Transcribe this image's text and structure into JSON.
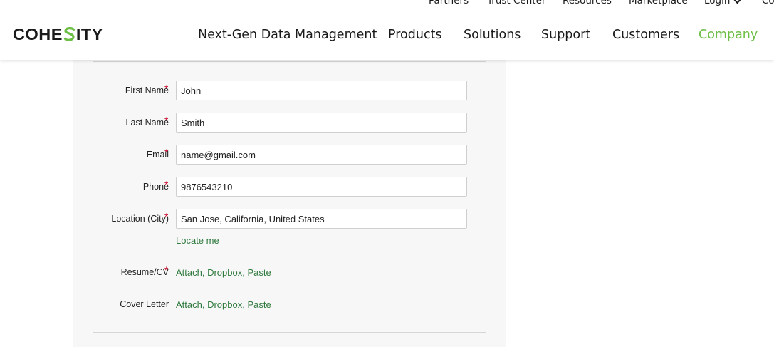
{
  "header": {
    "logo_text_left": "COHE",
    "logo_text_right": "ITY",
    "utility_links": {
      "partners": "Partners",
      "trust_center": "Trust Center",
      "resources": "Resources",
      "marketplace": "Marketplace",
      "login": "Login",
      "cut_off": "Co"
    },
    "nav": {
      "next_gen": "Next-Gen Data Management",
      "products": "Products",
      "solutions": "Solutions",
      "support": "Support",
      "customers": "Customers",
      "company": "Company"
    }
  },
  "form": {
    "required_mark": "*",
    "first_name": {
      "label": "First Name",
      "value": "John"
    },
    "last_name": {
      "label": "Last Name",
      "value": "Smith"
    },
    "email": {
      "label": "Email",
      "value": "name@gmail.com"
    },
    "phone": {
      "label": "Phone",
      "value": "9876543210"
    },
    "location": {
      "label": "Location (City)",
      "value": "San Jose, California, United States",
      "locate_link": "Locate me"
    },
    "resume": {
      "label": "Resume/CV",
      "attach": "Attach",
      "dropbox": "Dropbox",
      "paste": "Paste"
    },
    "cover_letter": {
      "label": "Cover Letter",
      "attach": "Attach",
      "dropbox": "Dropbox",
      "paste": "Paste"
    }
  },
  "colors": {
    "brand_green": "#6cbe45",
    "link_green": "#2f7a3e",
    "required_red": "#c8102e"
  }
}
